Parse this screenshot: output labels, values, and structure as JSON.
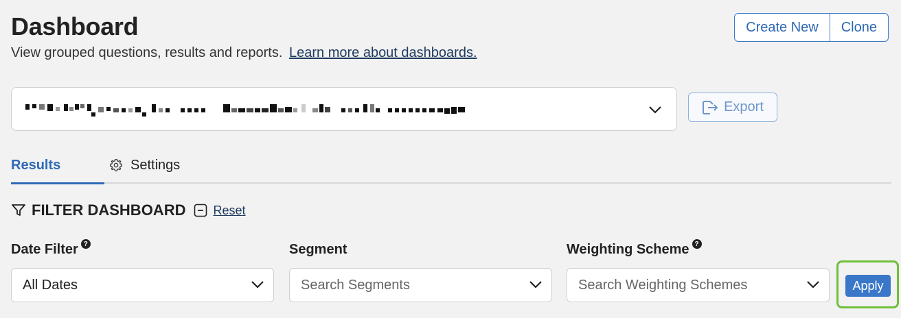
{
  "header": {
    "title": "Dashboard",
    "subtitle": "View grouped questions, results and reports.",
    "learn_more_link": "Learn more about dashboards."
  },
  "actions": {
    "create_new": "Create New",
    "clone": "Clone",
    "export": "Export"
  },
  "dashboard_select": {
    "selected_value_obscured": true,
    "icon": "chevron-down-icon"
  },
  "tabs": [
    {
      "label": "Results",
      "active": true
    },
    {
      "label": "Settings",
      "active": false,
      "icon": "gear-icon"
    }
  ],
  "filters": {
    "heading": "FILTER DASHBOARD",
    "reset": "Reset",
    "date_filter": {
      "label": "Date Filter",
      "value": "All Dates",
      "help": "?"
    },
    "segment": {
      "label": "Segment",
      "placeholder": "Search Segments"
    },
    "weighting_scheme": {
      "label": "Weighting Scheme",
      "placeholder": "Search Weighting Schemes",
      "help": "?"
    },
    "apply": "Apply"
  },
  "colors": {
    "accent": "#2e6ab6",
    "apply_button": "#3a77c9",
    "highlight_outline": "#6fbf3a"
  }
}
